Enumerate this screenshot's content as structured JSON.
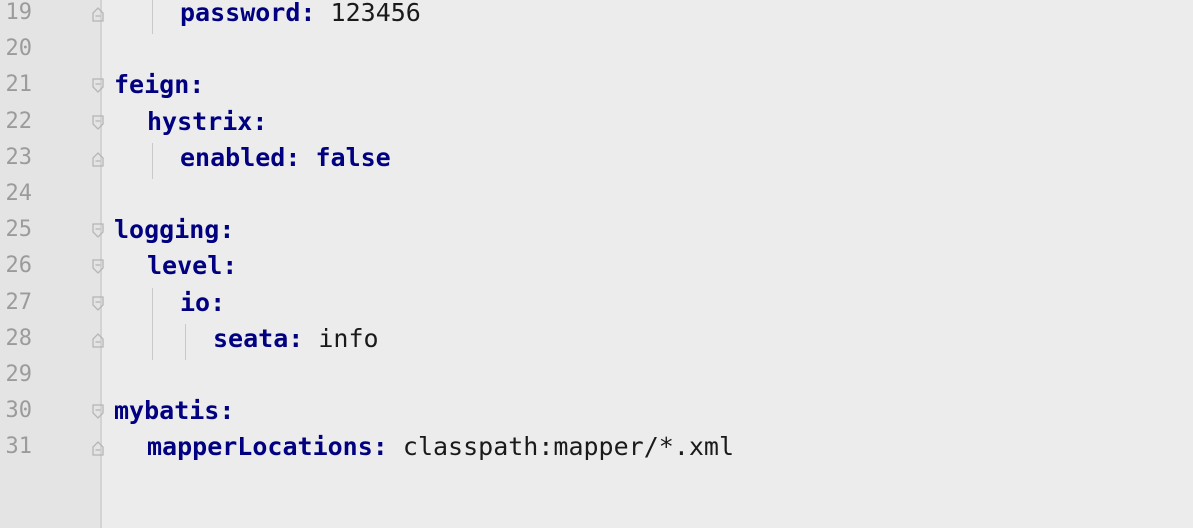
{
  "editor": {
    "lines": [
      {
        "number": "19",
        "key": "password",
        "colon": ":",
        "value": " 123456",
        "indent": 2,
        "fold": "end"
      },
      {
        "number": "20",
        "key": "",
        "colon": "",
        "value": "",
        "indent": 0,
        "fold": "none"
      },
      {
        "number": "21",
        "key": "feign",
        "colon": ":",
        "value": "",
        "indent": 0,
        "fold": "start"
      },
      {
        "number": "22",
        "key": "hystrix",
        "colon": ":",
        "value": "",
        "indent": 1,
        "fold": "start"
      },
      {
        "number": "23",
        "key": "enabled",
        "colon": ":",
        "value": " false",
        "indent": 2,
        "fold": "end",
        "bool": true
      },
      {
        "number": "24",
        "key": "",
        "colon": "",
        "value": "",
        "indent": 0,
        "fold": "none"
      },
      {
        "number": "25",
        "key": "logging",
        "colon": ":",
        "value": "",
        "indent": 0,
        "fold": "start"
      },
      {
        "number": "26",
        "key": "level",
        "colon": ":",
        "value": "",
        "indent": 1,
        "fold": "start"
      },
      {
        "number": "27",
        "key": "io",
        "colon": ":",
        "value": "",
        "indent": 2,
        "fold": "start"
      },
      {
        "number": "28",
        "key": "seata",
        "colon": ":",
        "value": " info",
        "indent": 3,
        "fold": "end"
      },
      {
        "number": "29",
        "key": "",
        "colon": "",
        "value": "",
        "indent": 0,
        "fold": "none"
      },
      {
        "number": "30",
        "key": "mybatis",
        "colon": ":",
        "value": "",
        "indent": 0,
        "fold": "start"
      },
      {
        "number": "31",
        "key": "mapperLocations",
        "colon": ":",
        "value": " classpath:mapper/*.xml",
        "indent": 1,
        "fold": "end"
      }
    ]
  },
  "colors": {
    "background": "#ececec",
    "gutter": "#e4e4e4",
    "key": "#000080",
    "line_number": "#9b9b9b"
  }
}
